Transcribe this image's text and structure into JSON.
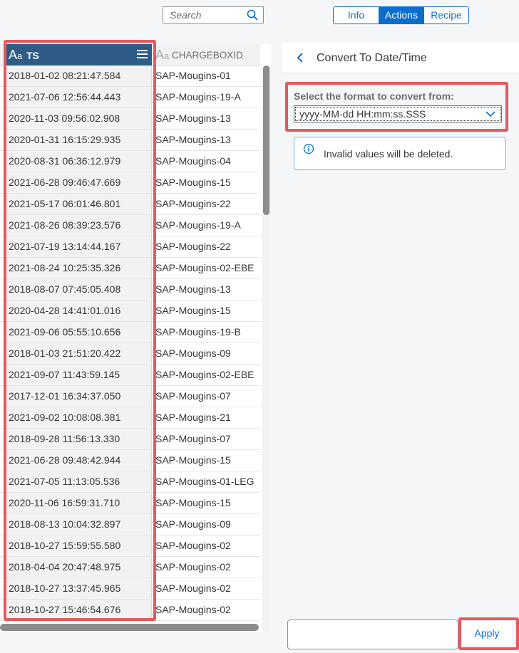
{
  "search": {
    "placeholder": "Search"
  },
  "tabs": [
    {
      "label": "Info",
      "active": false
    },
    {
      "label": "Actions",
      "active": true
    },
    {
      "label": "Recipe",
      "active": false
    }
  ],
  "grid": {
    "columns": [
      {
        "type_icon": "Aa",
        "name": "TS",
        "selected": true
      },
      {
        "type_icon": "Aa",
        "name": "CHARGEBOXID",
        "selected": false
      }
    ],
    "rows": [
      [
        "2018-01-02 08:21:47.584",
        "SAP-Mougins-01"
      ],
      [
        "2021-07-06 12:56:44.443",
        "SAP-Mougins-19-A"
      ],
      [
        "2020-11-03 09:56:02.908",
        "SAP-Mougins-13"
      ],
      [
        "2020-01-31 16:15:29.935",
        "SAP-Mougins-13"
      ],
      [
        "2020-08-31 06:36:12.979",
        "SAP-Mougins-04"
      ],
      [
        "2021-06-28 09:46:47.669",
        "SAP-Mougins-15"
      ],
      [
        "2021-05-17 06:01:46.801",
        "SAP-Mougins-22"
      ],
      [
        "2021-08-26 08:39:23.576",
        "SAP-Mougins-19-A"
      ],
      [
        "2021-07-19 13:14:44.167",
        "SAP-Mougins-22"
      ],
      [
        "2021-08-24 10:25:35.326",
        "SAP-Mougins-02-EBE"
      ],
      [
        "2018-08-07 07:45:05.408",
        "SAP-Mougins-13"
      ],
      [
        "2020-04-28 14:41:01.016",
        "SAP-Mougins-15"
      ],
      [
        "2021-09-06 05:55:10.656",
        "SAP-Mougins-19-B"
      ],
      [
        "2018-01-03 21:51:20.422",
        "SAP-Mougins-09"
      ],
      [
        "2021-09-07 11:43:59.145",
        "SAP-Mougins-02-EBE"
      ],
      [
        "2017-12-01 16:34:37.050",
        "SAP-Mougins-07"
      ],
      [
        "2021-09-02 10:08:08.381",
        "SAP-Mougins-21"
      ],
      [
        "2018-09-28 11:56:13.330",
        "SAP-Mougins-07"
      ],
      [
        "2021-06-28 09:48:42.944",
        "SAP-Mougins-15"
      ],
      [
        "2021-07-05 11:13:05.536",
        "SAP-Mougins-01-LEG"
      ],
      [
        "2020-11-06 16:59:31.710",
        "SAP-Mougins-15"
      ],
      [
        "2018-08-13 10:04:32.897",
        "SAP-Mougins-09"
      ],
      [
        "2018-10-27 15:59:55.580",
        "SAP-Mougins-02"
      ],
      [
        "2018-04-04 20:47:48.975",
        "SAP-Mougins-02"
      ],
      [
        "2018-10-27 13:37:45.965",
        "SAP-Mougins-02"
      ],
      [
        "2018-10-27 15:46:54.676",
        "SAP-Mougins-02"
      ]
    ]
  },
  "panel": {
    "title": "Convert To Date/Time",
    "format_label": "Select the format to convert from:",
    "format_value": "yyyy-MM-dd HH:mm:ss.SSS",
    "info_text": "Invalid values will be deleted.",
    "apply_label": "Apply"
  },
  "colors": {
    "accent": "#0a6ed1",
    "selected_header": "#2e5c87",
    "highlight": "#e8585c"
  }
}
